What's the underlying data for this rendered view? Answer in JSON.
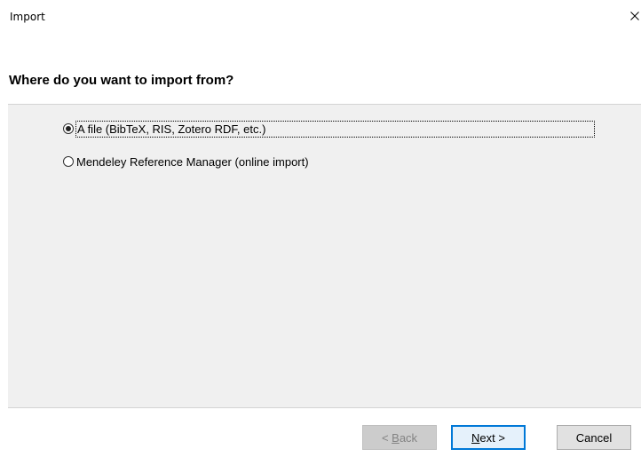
{
  "window": {
    "title": "Import"
  },
  "header": {
    "question": "Where do you want to import from?"
  },
  "options": [
    {
      "label": "A file (BibTeX, RIS, Zotero RDF, etc.)",
      "selected": true
    },
    {
      "label": "Mendeley Reference Manager (online import)",
      "selected": false
    }
  ],
  "buttons": {
    "back": {
      "prefix": "< ",
      "accel": "B",
      "rest": "ack",
      "enabled": false
    },
    "next": {
      "accel": "N",
      "rest": "ext >",
      "enabled": true
    },
    "cancel": {
      "label": "Cancel",
      "enabled": true
    }
  },
  "colors": {
    "content_bg": "#f0f0f0",
    "accent": "#0078d7"
  },
  "icons": {
    "close": "close-icon"
  }
}
